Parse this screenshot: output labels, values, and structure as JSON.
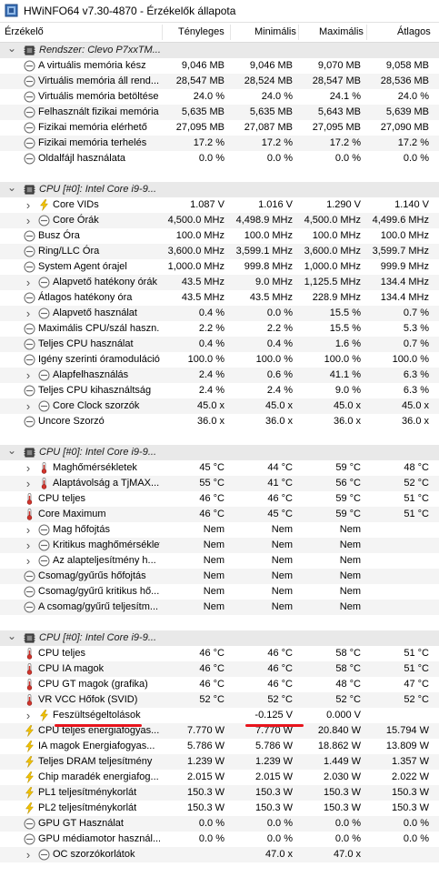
{
  "window": {
    "title": "HWiNFO64 v7.30-4870 - Érzékelők állapota"
  },
  "columns": [
    "Érzékelő",
    "Tényleges",
    "Minimális",
    "Maximális",
    "Átlagos"
  ],
  "groups": [
    {
      "label": "Rendszer: Clevo P7xxTM...",
      "rows": [
        {
          "icon": "gauge",
          "exp": false,
          "name": "A virtuális memória kész",
          "v": [
            "9,046 MB",
            "9,046 MB",
            "9,070 MB",
            "9,058 MB"
          ]
        },
        {
          "icon": "gauge",
          "exp": false,
          "name": "Virtuális memória áll rend...",
          "v": [
            "28,547 MB",
            "28,524 MB",
            "28,547 MB",
            "28,536 MB"
          ]
        },
        {
          "icon": "gauge",
          "exp": false,
          "name": "Virtuális memória betöltése",
          "v": [
            "24.0 %",
            "24.0 %",
            "24.1 %",
            "24.0 %"
          ]
        },
        {
          "icon": "gauge",
          "exp": false,
          "name": "Felhasznált fizikai memória",
          "v": [
            "5,635 MB",
            "5,635 MB",
            "5,643 MB",
            "5,639 MB"
          ]
        },
        {
          "icon": "gauge",
          "exp": false,
          "name": "Fizikai memória elérhető",
          "v": [
            "27,095 MB",
            "27,087 MB",
            "27,095 MB",
            "27,090 MB"
          ]
        },
        {
          "icon": "gauge",
          "exp": false,
          "name": "Fizikai memória terhelés",
          "v": [
            "17.2 %",
            "17.2 %",
            "17.2 %",
            "17.2 %"
          ]
        },
        {
          "icon": "gauge",
          "exp": false,
          "name": "Oldalfájl használata",
          "v": [
            "0.0 %",
            "0.0 %",
            "0.0 %",
            "0.0 %"
          ]
        }
      ]
    },
    {
      "label": "CPU [#0]: Intel Core i9-9...",
      "rows": [
        {
          "icon": "bolt",
          "exp": true,
          "name": "Core VIDs",
          "v": [
            "1.087 V",
            "1.016 V",
            "1.290 V",
            "1.140 V"
          ]
        },
        {
          "icon": "gauge",
          "exp": true,
          "name": "Core Órák",
          "v": [
            "4,500.0 MHz",
            "4,498.9 MHz",
            "4,500.0 MHz",
            "4,499.6 MHz"
          ]
        },
        {
          "icon": "gauge",
          "exp": false,
          "name": "Busz Óra",
          "v": [
            "100.0 MHz",
            "100.0 MHz",
            "100.0 MHz",
            "100.0 MHz"
          ]
        },
        {
          "icon": "gauge",
          "exp": false,
          "name": "Ring/LLC Óra",
          "v": [
            "3,600.0 MHz",
            "3,599.1 MHz",
            "3,600.0 MHz",
            "3,599.7 MHz"
          ]
        },
        {
          "icon": "gauge",
          "exp": false,
          "name": "System Agent órajel",
          "v": [
            "1,000.0 MHz",
            "999.8 MHz",
            "1,000.0 MHz",
            "999.9 MHz"
          ]
        },
        {
          "icon": "gauge",
          "exp": true,
          "name": "Alapvető hatékony órák",
          "v": [
            "43.5 MHz",
            "9.0 MHz",
            "1,125.5 MHz",
            "134.4 MHz"
          ]
        },
        {
          "icon": "gauge",
          "exp": false,
          "name": "Átlagos hatékony óra",
          "v": [
            "43.5 MHz",
            "43.5 MHz",
            "228.9 MHz",
            "134.4 MHz"
          ]
        },
        {
          "icon": "gauge",
          "exp": true,
          "name": "Alapvető használat",
          "v": [
            "0.4 %",
            "0.0 %",
            "15.5 %",
            "0.7 %"
          ]
        },
        {
          "icon": "gauge",
          "exp": false,
          "name": "Maximális CPU/szál haszn...",
          "v": [
            "2.2 %",
            "2.2 %",
            "15.5 %",
            "5.3 %"
          ]
        },
        {
          "icon": "gauge",
          "exp": false,
          "name": "Teljes CPU használat",
          "v": [
            "0.4 %",
            "0.4 %",
            "1.6 %",
            "0.7 %"
          ]
        },
        {
          "icon": "gauge",
          "exp": false,
          "name": "Igény szerinti óramoduláció",
          "v": [
            "100.0 %",
            "100.0 %",
            "100.0 %",
            "100.0 %"
          ]
        },
        {
          "icon": "gauge",
          "exp": true,
          "name": "Alapfelhasználás",
          "v": [
            "2.4 %",
            "0.6 %",
            "41.1 %",
            "6.3 %"
          ]
        },
        {
          "icon": "gauge",
          "exp": false,
          "name": "Teljes CPU kihasználtság",
          "v": [
            "2.4 %",
            "2.4 %",
            "9.0 %",
            "6.3 %"
          ]
        },
        {
          "icon": "gauge",
          "exp": true,
          "name": "Core Clock szorzók",
          "v": [
            "45.0 x",
            "45.0 x",
            "45.0 x",
            "45.0 x"
          ]
        },
        {
          "icon": "gauge",
          "exp": false,
          "name": "Uncore Szorzó",
          "v": [
            "36.0 x",
            "36.0 x",
            "36.0 x",
            "36.0 x"
          ]
        }
      ]
    },
    {
      "label": "CPU [#0]: Intel Core i9-9...",
      "rows": [
        {
          "icon": "thermo",
          "exp": true,
          "name": "Maghőmérsékletek",
          "v": [
            "45 °C",
            "44 °C",
            "59 °C",
            "48 °C"
          ]
        },
        {
          "icon": "thermo",
          "exp": true,
          "name": "Alaptávolság a TjMAX...",
          "v": [
            "55 °C",
            "41 °C",
            "56 °C",
            "52 °C"
          ]
        },
        {
          "icon": "thermo",
          "exp": false,
          "name": "CPU teljes",
          "v": [
            "46 °C",
            "46 °C",
            "59 °C",
            "51 °C"
          ]
        },
        {
          "icon": "thermo",
          "exp": false,
          "name": "Core Maximum",
          "v": [
            "46 °C",
            "45 °C",
            "59 °C",
            "51 °C"
          ]
        },
        {
          "icon": "gauge",
          "exp": true,
          "name": "Mag hőfojtás",
          "v": [
            "Nem",
            "Nem",
            "Nem",
            ""
          ]
        },
        {
          "icon": "gauge",
          "exp": true,
          "name": "Kritikus maghőmérséklet",
          "v": [
            "Nem",
            "Nem",
            "Nem",
            ""
          ]
        },
        {
          "icon": "gauge",
          "exp": true,
          "name": "Az alapteljesítmény h...",
          "v": [
            "Nem",
            "Nem",
            "Nem",
            ""
          ]
        },
        {
          "icon": "gauge",
          "exp": false,
          "name": "Csomag/gyűrűs hőfojtás",
          "v": [
            "Nem",
            "Nem",
            "Nem",
            ""
          ]
        },
        {
          "icon": "gauge",
          "exp": false,
          "name": "Csomag/gyűrű kritikus hő...",
          "v": [
            "Nem",
            "Nem",
            "Nem",
            ""
          ]
        },
        {
          "icon": "gauge",
          "exp": false,
          "name": "A csomag/gyűrű teljesítm...",
          "v": [
            "Nem",
            "Nem",
            "Nem",
            ""
          ]
        }
      ]
    },
    {
      "label": "CPU [#0]: Intel Core i9-9...",
      "rows": [
        {
          "icon": "thermo",
          "exp": false,
          "name": "CPU teljes",
          "v": [
            "46 °C",
            "46 °C",
            "58 °C",
            "51 °C"
          ]
        },
        {
          "icon": "thermo",
          "exp": false,
          "name": "CPU IA magok",
          "v": [
            "46 °C",
            "46 °C",
            "58 °C",
            "51 °C"
          ]
        },
        {
          "icon": "thermo",
          "exp": false,
          "name": "CPU GT magok (grafika)",
          "v": [
            "46 °C",
            "46 °C",
            "48 °C",
            "47 °C"
          ]
        },
        {
          "icon": "thermo",
          "exp": false,
          "name": "VR VCC Hőfok (SVID)",
          "v": [
            "52 °C",
            "52 °C",
            "52 °C",
            "52 °C"
          ]
        },
        {
          "icon": "bolt",
          "exp": true,
          "name": "Feszültségeltolások",
          "v": [
            "",
            "-0.125 V",
            "0.000 V",
            ""
          ]
        },
        {
          "icon": "bolt",
          "exp": false,
          "name": "CPU teljes energiafogyas...",
          "v": [
            "7.770 W",
            "7.770 W",
            "20.840 W",
            "15.794 W"
          ]
        },
        {
          "icon": "bolt",
          "exp": false,
          "name": "IA magok Energiafogyas...",
          "v": [
            "5.786 W",
            "5.786 W",
            "18.862 W",
            "13.809 W"
          ]
        },
        {
          "icon": "bolt",
          "exp": false,
          "name": "Teljes DRAM teljesítmény",
          "v": [
            "1.239 W",
            "1.239 W",
            "1.449 W",
            "1.357 W"
          ]
        },
        {
          "icon": "bolt",
          "exp": false,
          "name": "Chip maradék energiafog...",
          "v": [
            "2.015 W",
            "2.015 W",
            "2.030 W",
            "2.022 W"
          ]
        },
        {
          "icon": "bolt",
          "exp": false,
          "name": "PL1 teljesítménykorlát",
          "v": [
            "150.3 W",
            "150.3 W",
            "150.3 W",
            "150.3 W"
          ]
        },
        {
          "icon": "bolt",
          "exp": false,
          "name": "PL2 teljesítménykorlát",
          "v": [
            "150.3 W",
            "150.3 W",
            "150.3 W",
            "150.3 W"
          ]
        },
        {
          "icon": "gauge",
          "exp": false,
          "name": "GPU GT Használat",
          "v": [
            "0.0 %",
            "0.0 %",
            "0.0 %",
            "0.0 %"
          ]
        },
        {
          "icon": "gauge",
          "exp": false,
          "name": "GPU médiamotor használ...",
          "v": [
            "0.0 %",
            "0.0 %",
            "0.0 %",
            "0.0 %"
          ]
        },
        {
          "icon": "gauge",
          "exp": true,
          "name": "OC szorzókorlátok",
          "v": [
            "",
            "47.0 x",
            "47.0 x",
            ""
          ]
        }
      ]
    }
  ],
  "colors": {
    "accent_underline": "#e8141c",
    "bolt": "#f2c200",
    "thermo": "#d2342c"
  }
}
